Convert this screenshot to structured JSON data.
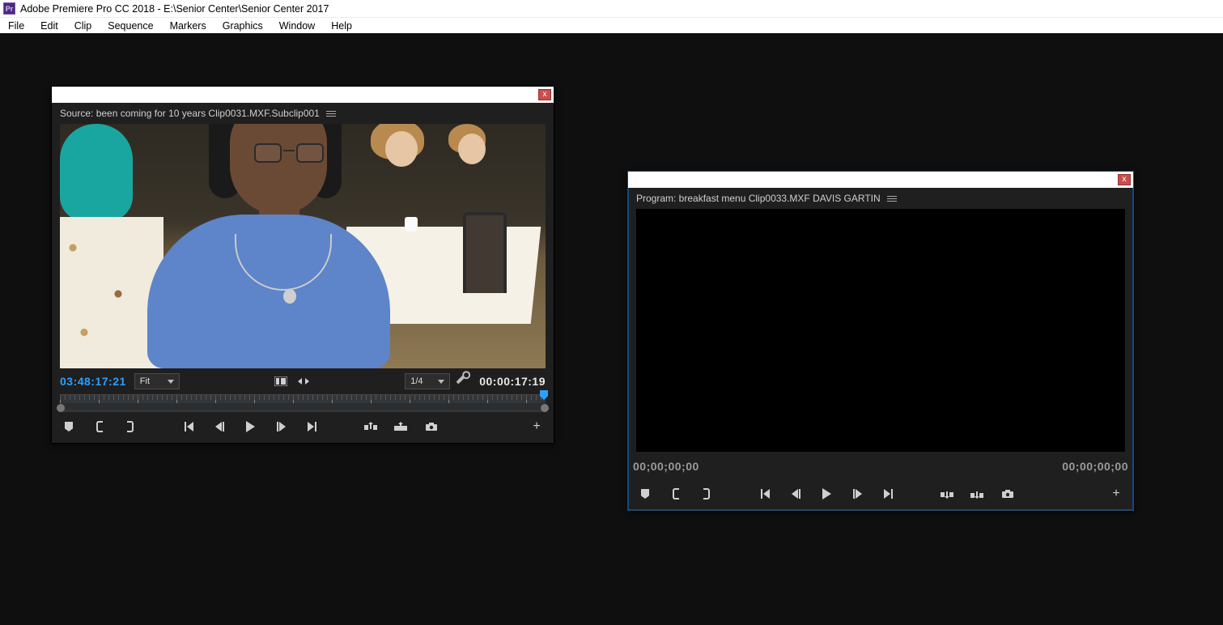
{
  "titlebar": {
    "title": "Adobe Premiere Pro CC 2018 - E:\\Senior Center\\Senior Center 2017"
  },
  "menu": {
    "items": [
      "File",
      "Edit",
      "Clip",
      "Sequence",
      "Markers",
      "Graphics",
      "Window",
      "Help"
    ]
  },
  "source": {
    "header": "Source: been coming for 10 years Clip0031.MXF.Subclip001",
    "tc_in": "03:48:17:21",
    "tc_out": "00:00:17:19",
    "zoom_label": "Fit",
    "res_label": "1/4"
  },
  "program": {
    "header": "Program: breakfast menu Clip0033.MXF DAVIS GARTIN",
    "tc_left": "00;00;00;00",
    "tc_right": "00;00;00;00"
  },
  "buttons": {
    "close": "x",
    "plus": "+"
  }
}
